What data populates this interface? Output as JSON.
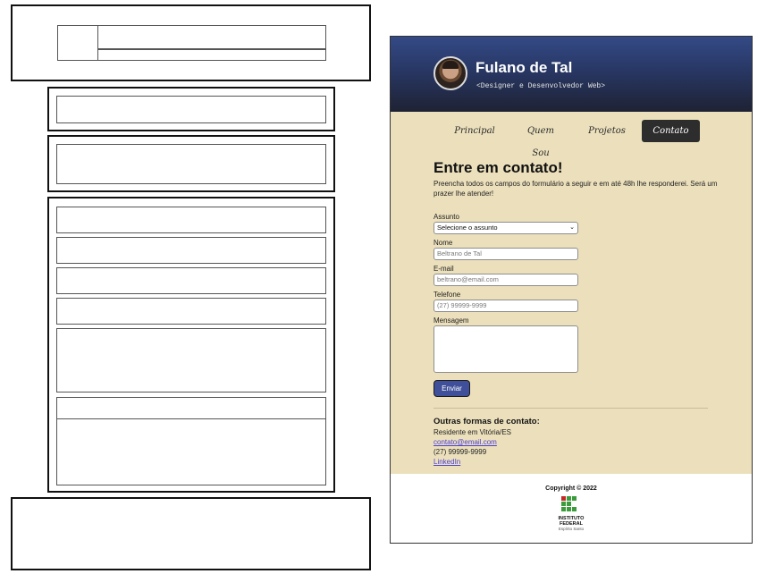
{
  "site": {
    "name": "Fulano de Tal",
    "tagline": "<Designer e Desenvolvedor Web>",
    "nav": [
      {
        "label": "Principal"
      },
      {
        "label": "Quem Sou"
      },
      {
        "label": "Projetos"
      },
      {
        "label": "Contato"
      }
    ],
    "active_nav": "Contato"
  },
  "contact_form": {
    "title": "Entre em contato!",
    "intro": "Preencha todos os campos do formulário a seguir e em até 48h lhe responderei. Será um prazer lhe atender!",
    "subject": {
      "label": "Assunto",
      "value": "Selecione o assunto"
    },
    "name": {
      "label": "Nome",
      "placeholder": "Beltrano de Tal"
    },
    "email": {
      "label": "E-mail",
      "placeholder": "beltrano@email.com"
    },
    "phone": {
      "label": "Telefone",
      "placeholder": "(27) 99999-9999"
    },
    "message": {
      "label": "Mensagem"
    },
    "submit_label": "Enviar"
  },
  "other_contacts": {
    "title": "Outras formas de contato:",
    "residence": "Residente em Vitória/ES",
    "email": "contato@email.com",
    "phone": "(27) 99999-9999",
    "linkedin": "LinkedIn"
  },
  "footer": {
    "copyright": "Copyright © 2022",
    "org_line1": "INSTITUTO",
    "org_line2": "FEDERAL",
    "org_line3": "Espírito Santo"
  },
  "colors": {
    "header_start": "#344a86",
    "header_end": "#1e2233",
    "background": "#ece0bc",
    "nav_active": "#2d2d2d",
    "button": "#3f4f99",
    "link": "#4a3fd6",
    "logo_green": "#3c9c3c",
    "logo_red": "#c62828"
  }
}
